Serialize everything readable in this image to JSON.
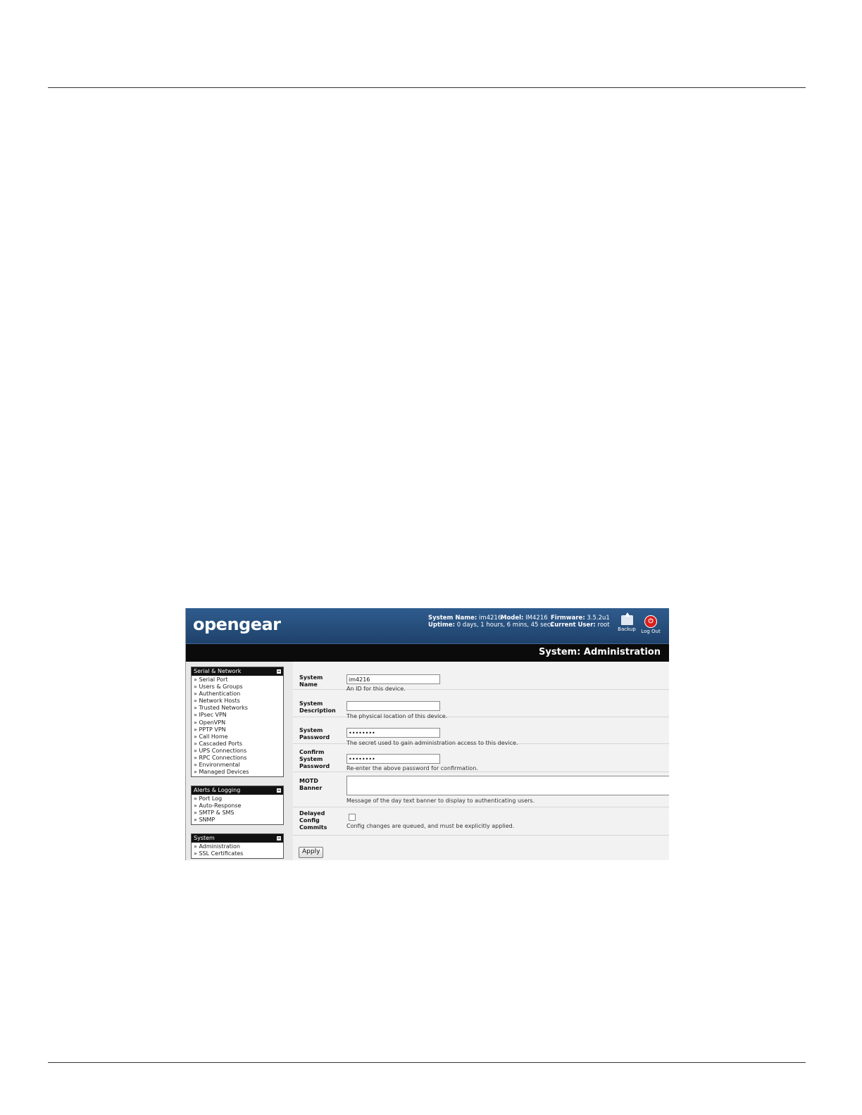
{
  "header": {
    "logo": "opengear",
    "system_name_label": "System Name:",
    "system_name": "im4216",
    "model_label": "Model:",
    "model": "IM4216",
    "firmware_label": "Firmware:",
    "firmware": "3.5.2u1",
    "uptime_label": "Uptime:",
    "uptime": "0 days, 1 hours, 6 mins, 45 secs",
    "current_user_label": "Current User:",
    "current_user": "root",
    "backup_label": "Backup",
    "logout_label": "Log Out"
  },
  "page_title": "System: Administration",
  "sidebar": {
    "sections": [
      {
        "title": "Serial & Network",
        "items": [
          "Serial Port",
          "Users & Groups",
          "Authentication",
          "Network Hosts",
          "Trusted Networks",
          "IPsec VPN",
          "OpenVPN",
          "PPTP VPN",
          "Call Home",
          "Cascaded Ports",
          "UPS Connections",
          "RPC Connections",
          "Environmental",
          "Managed Devices"
        ]
      },
      {
        "title": "Alerts & Logging",
        "items": [
          "Port Log",
          "Auto-Response",
          "SMTP & SMS",
          "SNMP"
        ]
      },
      {
        "title": "System",
        "items": [
          "Administration",
          "SSL Certificates"
        ]
      }
    ]
  },
  "form": {
    "system_name": {
      "label_1": "System",
      "label_2": "Name",
      "value": "im4216",
      "help": "An ID for this device."
    },
    "system_description": {
      "label_1": "System",
      "label_2": "Description",
      "value": "",
      "help": "The physical location of this device."
    },
    "system_password": {
      "label_1": "System",
      "label_2": "Password",
      "value": "••••••••",
      "help": "The secret used to gain administration access to this device."
    },
    "confirm_password": {
      "label_1": "Confirm",
      "label_2": "System",
      "label_3": "Password",
      "value": "••••••••",
      "help": "Re-enter the above password for confirmation."
    },
    "motd": {
      "label_1": "MOTD",
      "label_2": "Banner",
      "value": "",
      "help": "Message of the day text banner to display to authenticating users."
    },
    "delayed_commits": {
      "label_1": "Delayed",
      "label_2": "Config",
      "label_3": "Commits",
      "checked": false,
      "help": "Config changes are queued, and must be explicitly applied."
    },
    "apply_label": "Apply"
  }
}
